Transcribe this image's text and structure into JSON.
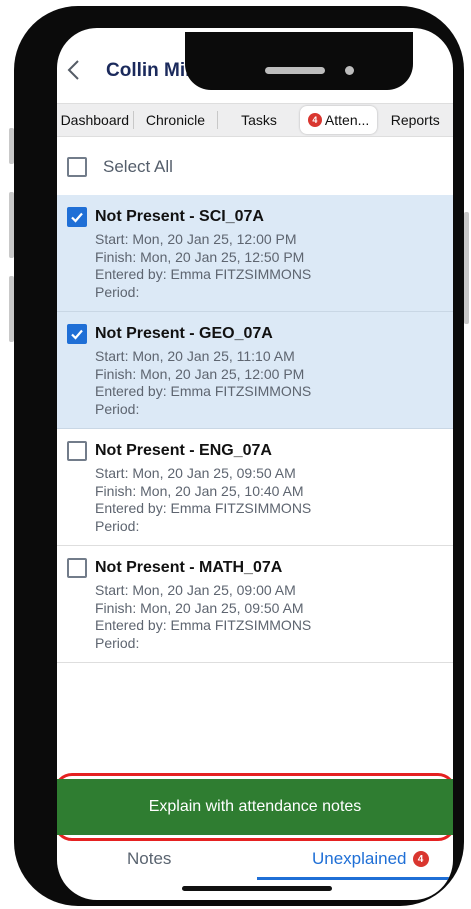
{
  "header": {
    "title": "Collin Miles"
  },
  "tabs": [
    {
      "label": "Dashboard"
    },
    {
      "label": "Chronicle"
    },
    {
      "label": "Tasks"
    },
    {
      "label": "Atten...",
      "badge": "4",
      "active": true
    },
    {
      "label": "Reports"
    }
  ],
  "select_all": {
    "label": "Select All",
    "checked": false
  },
  "records": [
    {
      "title": "Not Present - SCI_07A",
      "start": "Start: Mon, 20 Jan 25, 12:00 PM",
      "finish": "Finish: Mon, 20 Jan 25, 12:50 PM",
      "entered_by": "Entered by: Emma FITZSIMMONS",
      "period": "Period:",
      "checked": true
    },
    {
      "title": "Not Present - GEO_07A",
      "start": "Start: Mon, 20 Jan 25, 11:10 AM",
      "finish": "Finish: Mon, 20 Jan 25, 12:00 PM",
      "entered_by": "Entered by: Emma FITZSIMMONS",
      "period": "Period:",
      "checked": true
    },
    {
      "title": "Not Present - ENG_07A",
      "start": "Start: Mon, 20 Jan 25, 09:50 AM",
      "finish": "Finish: Mon, 20 Jan 25, 10:40 AM",
      "entered_by": "Entered by: Emma FITZSIMMONS",
      "period": "Period:",
      "checked": false
    },
    {
      "title": "Not Present - MATH_07A",
      "start": "Start: Mon, 20 Jan 25, 09:00 AM",
      "finish": "Finish: Mon, 20 Jan 25, 09:50 AM",
      "entered_by": "Entered by: Emma FITZSIMMONS",
      "period": "Period:",
      "checked": false
    }
  ],
  "explain_button": {
    "label": "Explain with attendance notes"
  },
  "bottom_tabs": {
    "notes": {
      "label": "Notes"
    },
    "unexplained": {
      "label": "Unexplained",
      "badge": "4",
      "active": true
    }
  },
  "colors": {
    "primary_green": "#2f7d31",
    "accent_blue": "#1f6fd6",
    "selected_row": "#dce9f6",
    "badge_red": "#d9362f",
    "highlight_outline": "#e52121",
    "title_navy": "#1b2a5c"
  },
  "icons": {
    "back": "chevron-left-icon",
    "checkbox_checked": "checkmark-icon"
  }
}
